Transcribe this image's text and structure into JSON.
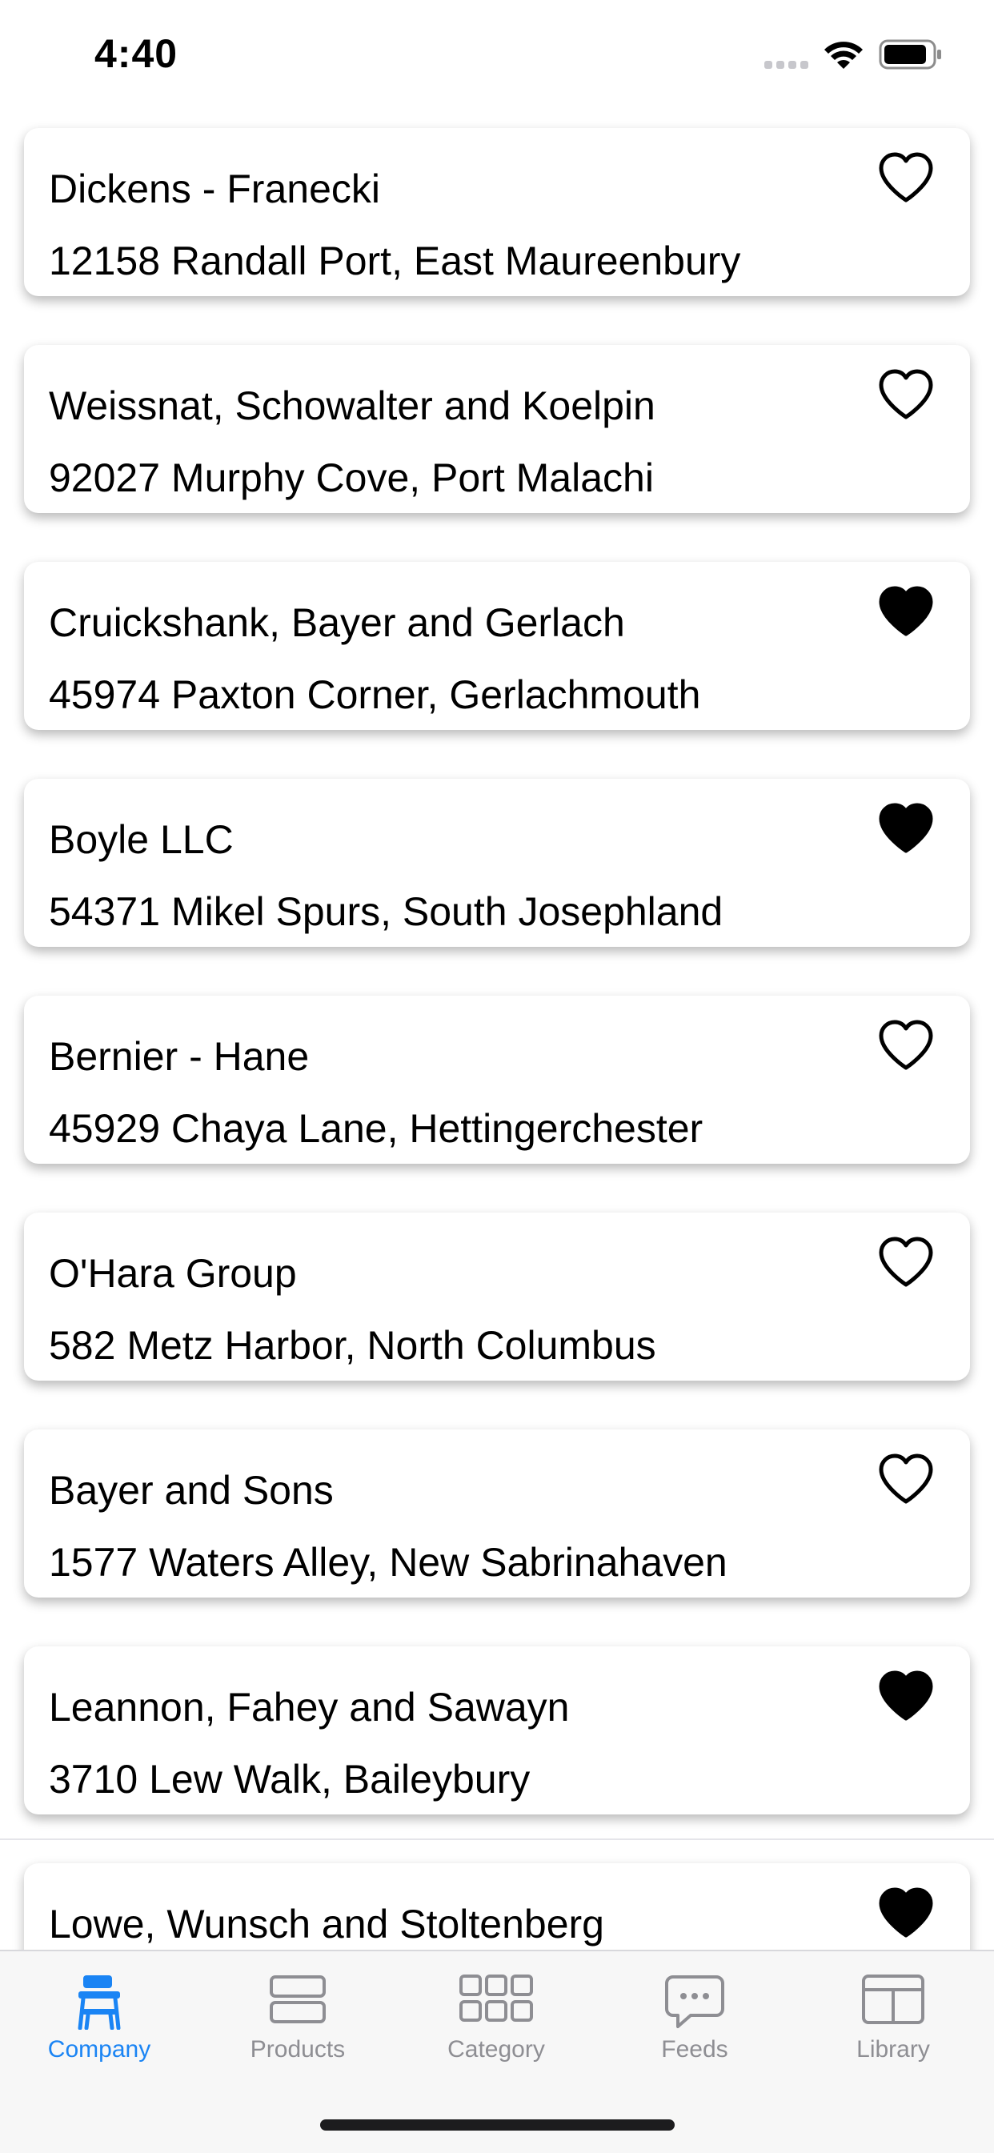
{
  "status_bar": {
    "time": "4:40"
  },
  "companies": [
    {
      "name": "Dickens - Franecki",
      "address": "12158 Randall Port, East Maureenbury",
      "favorite": false
    },
    {
      "name": "Weissnat, Schowalter and Koelpin",
      "address": "92027 Murphy Cove, Port Malachi",
      "favorite": false
    },
    {
      "name": "Cruickshank, Bayer and Gerlach",
      "address": "45974 Paxton Corner, Gerlachmouth",
      "favorite": true
    },
    {
      "name": "Boyle LLC",
      "address": "54371 Mikel Spurs, South Josephland",
      "favorite": true
    },
    {
      "name": "Bernier - Hane",
      "address": "45929 Chaya Lane, Hettingerchester",
      "favorite": false
    },
    {
      "name": "O'Hara Group",
      "address": "582 Metz Harbor, North Columbus",
      "favorite": false
    },
    {
      "name": "Bayer and Sons",
      "address": "1577 Waters Alley, New Sabrinahaven",
      "favorite": false
    },
    {
      "name": "Leannon, Fahey and Sawayn",
      "address": "3710 Lew Walk, Baileybury",
      "favorite": true
    },
    {
      "name": "Lowe, Wunsch and Stoltenberg",
      "address": "",
      "favorite": true
    }
  ],
  "tab_bar": {
    "tabs": [
      {
        "label": "Company",
        "icon": "desk-chair-icon",
        "active": true
      },
      {
        "label": "Products",
        "icon": "rows-icon",
        "active": false
      },
      {
        "label": "Category",
        "icon": "grid-icon",
        "active": false
      },
      {
        "label": "Feeds",
        "icon": "chat-bubble-icon",
        "active": false
      },
      {
        "label": "Library",
        "icon": "library-icon",
        "active": false
      }
    ]
  },
  "colors": {
    "accent": "#1a84f4",
    "inactive": "#8e8e93"
  }
}
